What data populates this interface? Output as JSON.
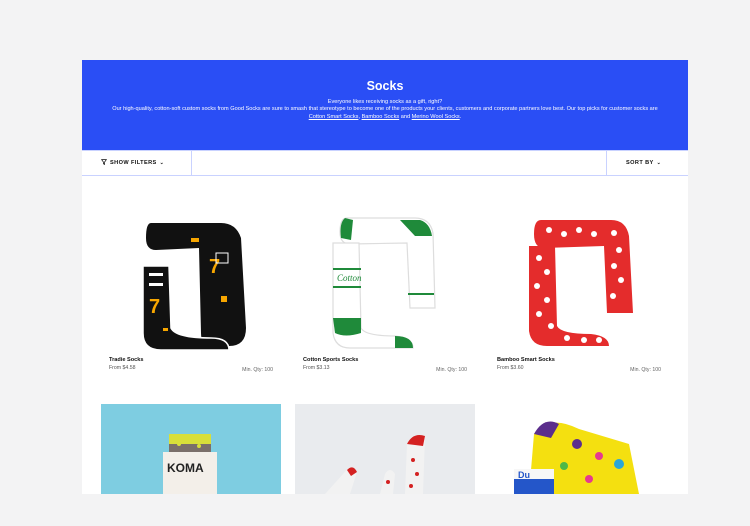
{
  "hero": {
    "title": "Socks",
    "line1": "Everyone likes receiving socks as a gift, right?",
    "line2_pre": "Our high-quality, cotton-soft custom socks from Good Socks are sure to smash that stereotype to become one of the products your clients, customers and corporate partners love best. Our top picks for customer socks are ",
    "link1": "Cotton Smart Socks",
    "sep1": ", ",
    "link2": "Bamboo Socks",
    "sep2": " and ",
    "link3": "Merino Wool Socks",
    "end": "."
  },
  "toolbar": {
    "filters_label": "SHOW FILTERS",
    "sort_label": "SORT BY"
  },
  "products": [
    {
      "name": "Tradie Socks",
      "price": "From $4.58",
      "min_qty": "Min. Qty: 100"
    },
    {
      "name": "Cotton Sports Socks",
      "price": "From $3.13",
      "min_qty": "Min. Qty: 100"
    },
    {
      "name": "Bamboo Smart Socks",
      "price": "From $3.60",
      "min_qty": "Min. Qty: 100"
    }
  ],
  "photos": [
    {
      "brand_text": "KOMA"
    },
    {
      "brand_text": ""
    },
    {
      "brand_text": "Du"
    }
  ],
  "colors": {
    "accent": "#2a4ef5"
  }
}
